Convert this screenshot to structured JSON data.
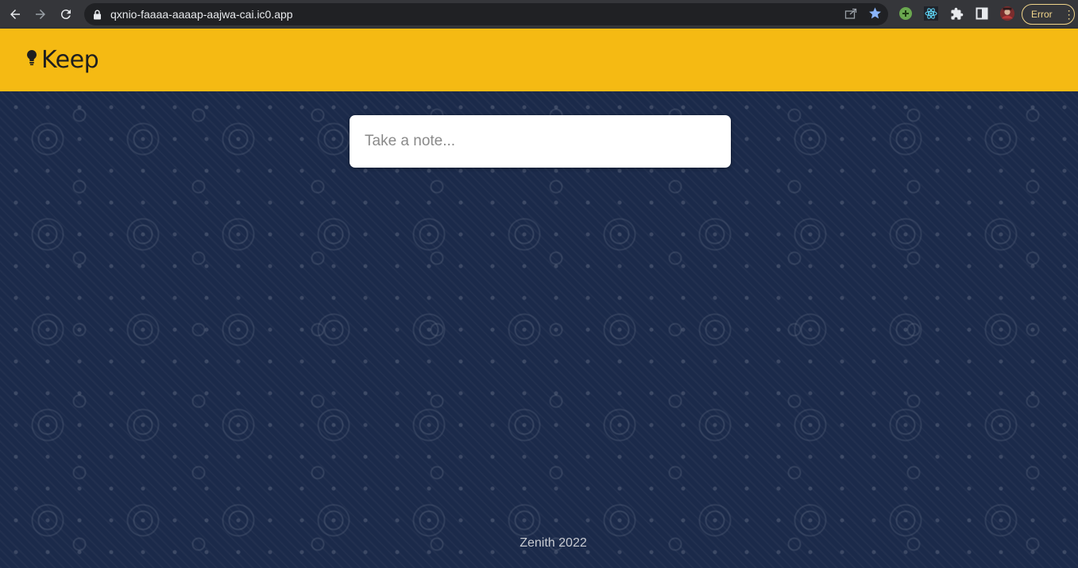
{
  "browser": {
    "url": "qxnio-faaaa-aaaap-aajwa-cai.ic0.app",
    "error_label": "Error",
    "icons": [
      "back-arrow-icon",
      "forward-arrow-icon",
      "reload-icon",
      "lock-icon",
      "share-icon",
      "star-icon",
      "extension-green-icon",
      "react-devtools-icon",
      "puzzle-icon",
      "side-panel-icon",
      "profile-avatar",
      "kebab-menu-icon"
    ]
  },
  "header": {
    "logo_text": "Keep",
    "logo_icon": "lightbulb-icon",
    "bg_color": "#f5ba13"
  },
  "main": {
    "note_placeholder": "Take a note...",
    "background_color": "#1b2a4a"
  },
  "footer": {
    "text": "Zenith 2022"
  }
}
